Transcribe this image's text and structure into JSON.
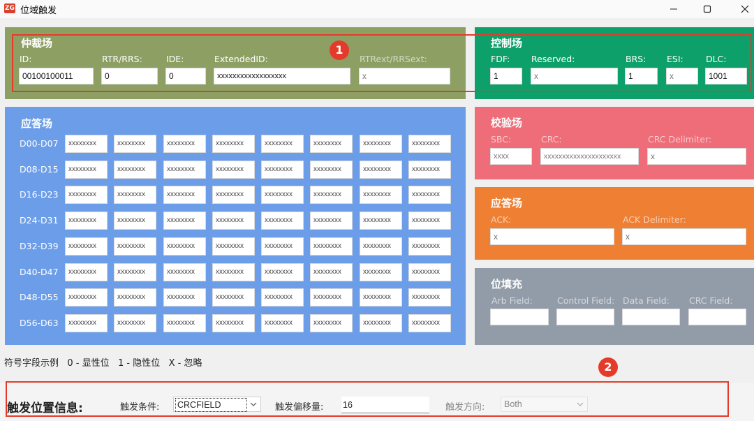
{
  "window": {
    "title": "位域触发",
    "icon_text": "ZG"
  },
  "arbitration": {
    "title": "仲裁场",
    "fields": [
      {
        "label": "ID:",
        "value": "00100100011"
      },
      {
        "label": "RTR/RRS:",
        "value": "0"
      },
      {
        "label": "IDE:",
        "value": "0"
      },
      {
        "label": "ExtendedID:",
        "value": "xxxxxxxxxxxxxxxxxx"
      },
      {
        "label": "RTRext/RRSext:",
        "value": "x"
      }
    ]
  },
  "control": {
    "title": "控制场",
    "fields": [
      {
        "label": "FDF:",
        "value": "1"
      },
      {
        "label": "Reserved:",
        "value": "x"
      },
      {
        "label": "BRS:",
        "value": "1"
      },
      {
        "label": "ESI:",
        "value": "x"
      },
      {
        "label": "DLC:",
        "value": "1001"
      }
    ]
  },
  "data_field": {
    "title": "应答场",
    "rows": [
      {
        "label": "D00-D07",
        "cells": [
          "xxxxxxxx",
          "xxxxxxxx",
          "xxxxxxxx",
          "xxxxxxxx",
          "xxxxxxxx",
          "xxxxxxxx",
          "xxxxxxxx",
          "xxxxxxxx"
        ]
      },
      {
        "label": "D08-D15",
        "cells": [
          "xxxxxxxx",
          "xxxxxxxx",
          "xxxxxxxx",
          "xxxxxxxx",
          "xxxxxxxx",
          "xxxxxxxx",
          "xxxxxxxx",
          "xxxxxxxx"
        ]
      },
      {
        "label": "D16-D23",
        "cells": [
          "xxxxxxxx",
          "xxxxxxxx",
          "xxxxxxxx",
          "xxxxxxxx",
          "xxxxxxxx",
          "xxxxxxxx",
          "xxxxxxxx",
          "xxxxxxxx"
        ]
      },
      {
        "label": "D24-D31",
        "cells": [
          "xxxxxxxx",
          "xxxxxxxx",
          "xxxxxxxx",
          "xxxxxxxx",
          "xxxxxxxx",
          "xxxxxxxx",
          "xxxxxxxx",
          "xxxxxxxx"
        ]
      },
      {
        "label": "D32-D39",
        "cells": [
          "xxxxxxxx",
          "xxxxxxxx",
          "xxxxxxxx",
          "xxxxxxxx",
          "xxxxxxxx",
          "xxxxxxxx",
          "xxxxxxxx",
          "xxxxxxxx"
        ]
      },
      {
        "label": "D40-D47",
        "cells": [
          "xxxxxxxx",
          "xxxxxxxx",
          "xxxxxxxx",
          "xxxxxxxx",
          "xxxxxxxx",
          "xxxxxxxx",
          "xxxxxxxx",
          "xxxxxxxx"
        ]
      },
      {
        "label": "D48-D55",
        "cells": [
          "xxxxxxxx",
          "xxxxxxxx",
          "xxxxxxxx",
          "xxxxxxxx",
          "xxxxxxxx",
          "xxxxxxxx",
          "xxxxxxxx",
          "xxxxxxxx"
        ]
      },
      {
        "label": "D56-D63",
        "cells": [
          "xxxxxxxx",
          "xxxxxxxx",
          "xxxxxxxx",
          "xxxxxxxx",
          "xxxxxxxx",
          "xxxxxxxx",
          "xxxxxxxx",
          "xxxxxxxx"
        ]
      }
    ]
  },
  "crc": {
    "title": "校验场",
    "fields": [
      {
        "label": "SBC:",
        "value": "xxxx"
      },
      {
        "label": "CRC:",
        "value": "xxxxxxxxxxxxxxxxxxxxx"
      },
      {
        "label": "CRC Delimiter:",
        "value": "x"
      }
    ]
  },
  "ack": {
    "title": "应答场",
    "fields": [
      {
        "label": "ACK:",
        "value": "x"
      },
      {
        "label": "ACK Delimiter:",
        "value": "x"
      }
    ]
  },
  "stuffing": {
    "title": "位填充",
    "fields": [
      {
        "label": "Arb Field:",
        "value": ""
      },
      {
        "label": "Control Field:",
        "value": ""
      },
      {
        "label": "Data Field:",
        "value": ""
      },
      {
        "label": "CRC Field:",
        "value": ""
      }
    ]
  },
  "legend": "符号字段示例   0 - 显性位   1 - 隐性位   X - 忽略",
  "trigger": {
    "title": "触发位置信息:",
    "condition_label": "触发条件:",
    "condition_value": "CRCFIELD",
    "offset_label": "触发偏移量:",
    "offset_value": "16",
    "direction_label": "触发方向:",
    "direction_value": "Both"
  },
  "annotations": {
    "badge1": "1",
    "badge2": "2"
  },
  "colors": {
    "arbitration": "#8e9f64",
    "control": "#0ea06a",
    "data": "#6c9de8",
    "crc": "#ee6d79",
    "ack": "#ee7f33",
    "stuffing": "#929ca8",
    "highlight": "#e53a2a"
  }
}
